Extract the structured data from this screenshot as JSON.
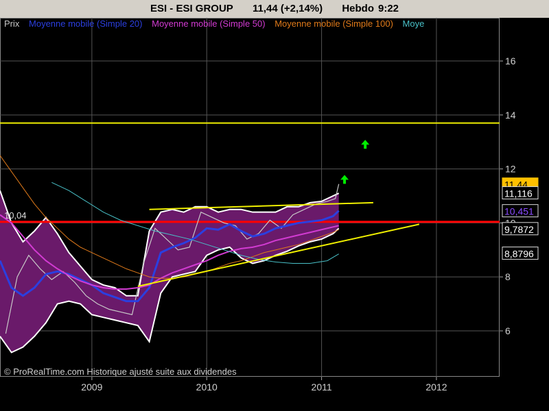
{
  "header": {
    "ticker": "ESI - ESI GROUP",
    "quote": "11,44 (+2,14%)",
    "period": "Hebdo",
    "time": "9:22"
  },
  "legend": {
    "price": "Prix",
    "ma20": "Moyenne mobile (Simple 20)",
    "ma50": "Moyenne mobile (Simple 50)",
    "ma100": "Moyenne mobile (Simple 100)",
    "truncated": "Moye"
  },
  "copyright": "© ProRealTime.com Historique ajusté suite aux dividendes",
  "colors": {
    "ma20": "#2b3fe0",
    "ma50": "#d23bd2",
    "ma100": "#e07a1a",
    "ma200": "#49c1c8",
    "price": "#c8c8c8",
    "band": "#6a1a6a",
    "trend": "#f0f000",
    "support": "#ff0000"
  },
  "chart_data": {
    "type": "line",
    "ylim": [
      4.3,
      17.6
    ],
    "xlim": [
      2008.2,
      2012.55
    ],
    "y_ticks": [
      6,
      8,
      10,
      12,
      14,
      16
    ],
    "x_ticks": [
      2009,
      2010,
      2011,
      2012
    ],
    "level_label": "10,04",
    "horizontal_lines": [
      {
        "name": "support",
        "value": 10.04
      },
      {
        "name": "resistance",
        "value": 13.7
      }
    ],
    "trendlines": [
      {
        "name": "upper-channel",
        "x": [
          2009.5,
          2011.45
        ],
        "y": [
          10.5,
          10.75
        ]
      },
      {
        "name": "rising-support",
        "x": [
          2009.4,
          2011.85
        ],
        "y": [
          7.65,
          9.95
        ]
      }
    ],
    "price_labels": [
      {
        "text": "11,44",
        "value": 11.44,
        "color": "#ffc000",
        "filled": true
      },
      {
        "text": "11,116",
        "value": 11.116,
        "color": "#ffffff",
        "filled": false
      },
      {
        "text": "10,451",
        "value": 10.451,
        "color": "#8a4cff",
        "filled": false
      },
      {
        "text": "9,7872",
        "value": 9.7872,
        "color": "#ffffff",
        "filled": false
      },
      {
        "text": "8,8796",
        "value": 8.8796,
        "color": "#ffffff",
        "filled": false
      }
    ],
    "arrows": [
      {
        "x": 2011.2,
        "y": 11.6
      },
      {
        "x": 2011.38,
        "y": 12.9
      }
    ],
    "series": [
      {
        "name": "Prix",
        "x": [
          2008.25,
          2008.35,
          2008.45,
          2008.55,
          2008.65,
          2008.75,
          2008.85,
          2008.95,
          2009.05,
          2009.15,
          2009.25,
          2009.35,
          2009.45,
          2009.55,
          2009.65,
          2009.75,
          2009.85,
          2009.95,
          2010.05,
          2010.15,
          2010.25,
          2010.35,
          2010.45,
          2010.55,
          2010.65,
          2010.75,
          2010.85,
          2010.95,
          2011.05,
          2011.12,
          2011.15
        ],
        "y": [
          5.9,
          8.0,
          8.8,
          8.3,
          7.9,
          8.2,
          7.8,
          7.3,
          7.0,
          6.8,
          6.7,
          6.6,
          8.5,
          9.8,
          9.4,
          9.0,
          9.1,
          10.4,
          10.2,
          10.0,
          9.9,
          9.4,
          9.6,
          10.1,
          9.8,
          10.3,
          10.5,
          10.7,
          10.8,
          10.9,
          11.44
        ]
      },
      {
        "name": "Moyenne mobile (Simple 20)",
        "x": [
          2008.2,
          2008.3,
          2008.4,
          2008.5,
          2008.6,
          2008.7,
          2008.8,
          2008.9,
          2009.0,
          2009.1,
          2009.2,
          2009.3,
          2009.4,
          2009.5,
          2009.6,
          2009.7,
          2009.8,
          2009.9,
          2010.0,
          2010.1,
          2010.2,
          2010.3,
          2010.4,
          2010.5,
          2010.6,
          2010.7,
          2010.8,
          2010.9,
          2011.0,
          2011.1,
          2011.15
        ],
        "y": [
          8.6,
          7.6,
          7.3,
          7.6,
          8.1,
          8.2,
          8.1,
          7.9,
          7.7,
          7.4,
          7.25,
          7.1,
          7.1,
          7.6,
          8.9,
          9.1,
          9.25,
          9.45,
          9.8,
          9.75,
          9.95,
          9.7,
          9.5,
          9.6,
          9.8,
          9.9,
          10.0,
          10.05,
          10.1,
          10.25,
          10.45
        ]
      },
      {
        "name": "Moyenne mobile (Simple 50)",
        "x": [
          2008.2,
          2008.3,
          2008.4,
          2008.5,
          2008.6,
          2008.7,
          2008.8,
          2008.9,
          2009.0,
          2009.1,
          2009.2,
          2009.3,
          2009.4,
          2009.5,
          2009.6,
          2009.7,
          2009.8,
          2009.9,
          2010.0,
          2010.1,
          2010.2,
          2010.3,
          2010.4,
          2010.5,
          2010.6,
          2010.7,
          2010.8,
          2010.9,
          2011.0,
          2011.1,
          2011.15
        ],
        "y": [
          10.3,
          10.0,
          9.5,
          9.0,
          8.6,
          8.3,
          8.05,
          7.85,
          7.7,
          7.6,
          7.55,
          7.55,
          7.6,
          7.7,
          7.95,
          8.15,
          8.3,
          8.45,
          8.6,
          8.8,
          8.95,
          9.05,
          9.1,
          9.2,
          9.35,
          9.45,
          9.55,
          9.65,
          9.75,
          9.85,
          9.9
        ]
      },
      {
        "name": "Moyenne mobile (Simple 100)",
        "x": [
          2008.2,
          2008.3,
          2008.4,
          2008.5,
          2008.6,
          2008.7,
          2008.8,
          2008.9,
          2009.0,
          2009.1,
          2009.2,
          2009.3,
          2009.4,
          2009.5,
          2009.6,
          2009.7,
          2009.8,
          2009.9,
          2010.0,
          2010.1,
          2010.2,
          2010.3,
          2010.4,
          2010.5,
          2010.6,
          2010.7,
          2010.8,
          2010.9,
          2011.0,
          2011.1,
          2011.15
        ],
        "y": [
          12.5,
          11.9,
          11.3,
          10.7,
          10.2,
          9.8,
          9.4,
          9.1,
          8.9,
          8.7,
          8.5,
          8.3,
          8.15,
          8.0,
          7.95,
          7.95,
          8.0,
          8.1,
          8.2,
          8.35,
          8.5,
          8.6,
          8.75,
          8.9,
          9.0,
          9.1,
          9.2,
          9.35,
          9.5,
          9.65,
          9.75
        ]
      },
      {
        "name": "Moye",
        "x": [
          2008.65,
          2008.8,
          2008.95,
          2009.1,
          2009.25,
          2009.4,
          2009.55,
          2009.7,
          2009.85,
          2010.0,
          2010.15,
          2010.3,
          2010.45,
          2010.6,
          2010.75,
          2010.9,
          2011.05,
          2011.15
        ],
        "y": [
          11.5,
          11.2,
          10.8,
          10.4,
          10.1,
          9.9,
          9.7,
          9.55,
          9.4,
          9.2,
          9.0,
          8.8,
          8.65,
          8.55,
          8.5,
          8.5,
          8.6,
          8.85
        ]
      }
    ],
    "bands": {
      "x": [
        2008.2,
        2008.3,
        2008.4,
        2008.5,
        2008.6,
        2008.7,
        2008.8,
        2008.9,
        2009.0,
        2009.1,
        2009.2,
        2009.3,
        2009.4,
        2009.5,
        2009.6,
        2009.7,
        2009.8,
        2009.9,
        2010.0,
        2010.1,
        2010.2,
        2010.3,
        2010.4,
        2010.5,
        2010.6,
        2010.7,
        2010.8,
        2010.9,
        2011.0,
        2011.1,
        2011.15
      ],
      "upper": [
        11.2,
        10.0,
        9.3,
        9.7,
        10.2,
        9.6,
        8.9,
        8.4,
        7.9,
        7.7,
        7.6,
        7.3,
        7.3,
        9.7,
        10.4,
        10.5,
        10.4,
        10.6,
        10.6,
        10.4,
        10.5,
        10.5,
        10.4,
        10.4,
        10.4,
        10.6,
        10.6,
        10.75,
        10.8,
        11.0,
        11.1
      ],
      "lower": [
        5.8,
        5.2,
        5.4,
        5.8,
        6.3,
        7.0,
        7.1,
        7.0,
        6.6,
        6.5,
        6.4,
        6.3,
        6.2,
        5.6,
        7.4,
        8.0,
        8.1,
        8.2,
        8.8,
        9.0,
        9.1,
        8.7,
        8.5,
        8.6,
        8.8,
        8.95,
        9.15,
        9.3,
        9.4,
        9.6,
        9.8
      ]
    }
  }
}
